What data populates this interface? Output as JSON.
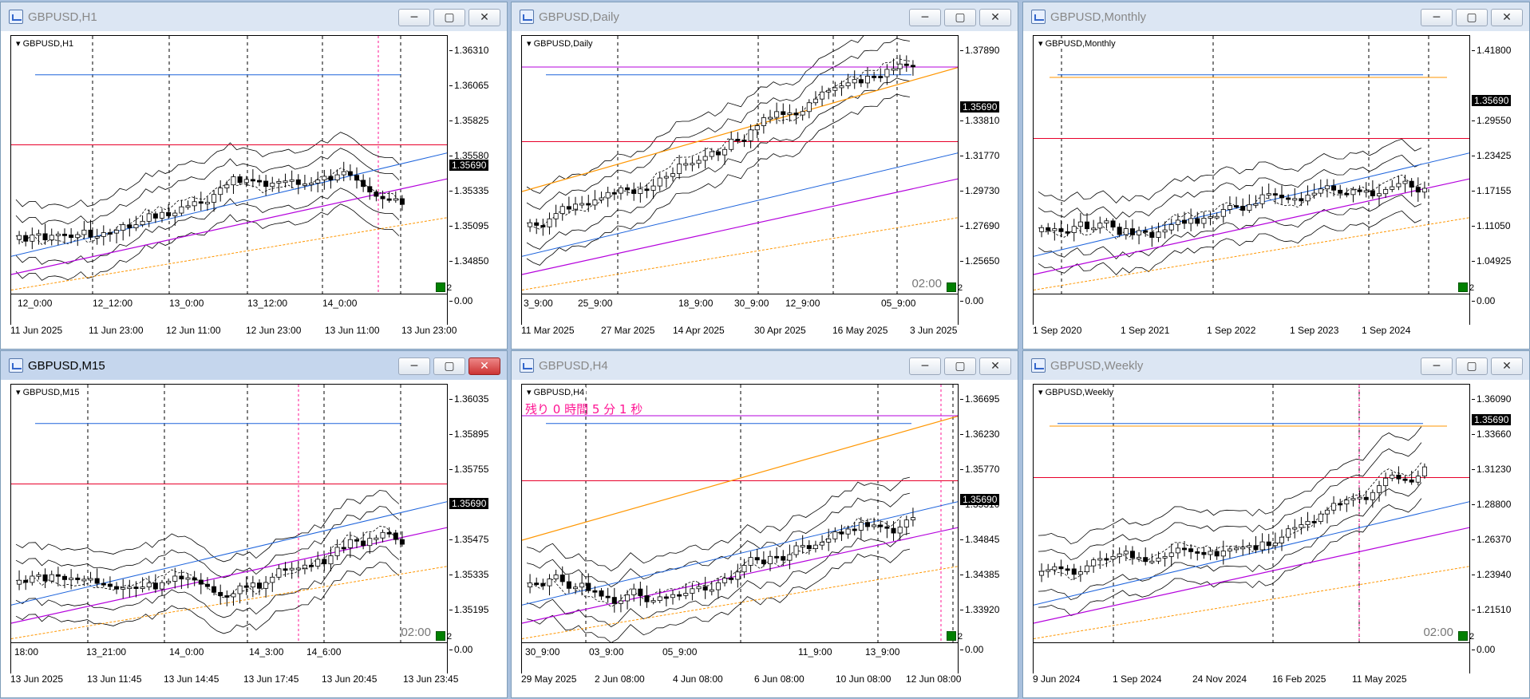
{
  "windows": [
    {
      "title": "GBPUSD,H1",
      "symbol": "GBPUSD,H1",
      "active": false,
      "close_red": false,
      "prices": [
        "1.36310",
        "1.36065",
        "1.35825",
        "1.35580",
        "1.35335",
        "1.35095",
        "1.34850",
        "0.00"
      ],
      "current_price": "1.35690",
      "time_labels": [
        "12_0:00",
        "12_12:00",
        "13_0:00",
        "13_12:00",
        "14_0:00"
      ],
      "date_labels": [
        "11 Jun 2025",
        "11 Jun 23:00",
        "12 Jun 11:00",
        "12 Jun 23:00",
        "13 Jun 11:00",
        "13 Jun 23:00"
      ],
      "axis_zero": "2",
      "countdown": "",
      "timer": ""
    },
    {
      "title": "GBPUSD,Daily",
      "symbol": "GBPUSD,Daily",
      "active": false,
      "close_red": false,
      "prices": [
        "1.37890",
        "1.35690",
        "1.33810",
        "1.31770",
        "1.29730",
        "1.27690",
        "1.25650",
        "0.00"
      ],
      "current_price": "1.35690",
      "time_labels": [
        "3_9:00",
        "25_9:00",
        "18_9:00",
        "30_9:00",
        "12_9:00",
        "05_9:00"
      ],
      "date_labels": [
        "11 Mar 2025",
        "27 Mar 2025",
        "14 Apr 2025",
        "30 Apr 2025",
        "16 May 2025",
        "3 Jun 2025"
      ],
      "axis_zero": "2",
      "countdown": "",
      "timer": "02:00"
    },
    {
      "title": "GBPUSD,Monthly",
      "symbol": "GBPUSD,Monthly",
      "active": false,
      "close_red": false,
      "prices": [
        "1.41800",
        "1.35690",
        "1.29550",
        "1.23425",
        "1.17155",
        "1.11050",
        "1.04925",
        "0.00"
      ],
      "current_price": "1.35690",
      "time_labels": [],
      "date_labels": [
        "1 Sep 2020",
        "1 Sep 2021",
        "1 Sep 2022",
        "1 Sep 2023",
        "1 Sep 2024"
      ],
      "axis_zero": "2",
      "countdown": "",
      "timer": ""
    },
    {
      "title": "GBPUSD,M15",
      "symbol": "GBPUSD,M15",
      "active": true,
      "close_red": true,
      "prices": [
        "1.36035",
        "1.35895",
        "1.35755",
        "1.35615",
        "1.35475",
        "1.35335",
        "1.35195",
        "0.00"
      ],
      "current_price": "1.35690",
      "time_labels": [
        "18:00",
        "13_21:00",
        "14_0:00",
        "14_3:00",
        "14_6:00"
      ],
      "date_labels": [
        "13 Jun 2025",
        "13 Jun 11:45",
        "13 Jun 14:45",
        "13 Jun 17:45",
        "13 Jun 20:45",
        "13 Jun 23:45"
      ],
      "axis_zero": "2",
      "countdown": "",
      "timer": "02:00"
    },
    {
      "title": "GBPUSD,H4",
      "symbol": "GBPUSD,H4",
      "active": false,
      "close_red": false,
      "prices": [
        "1.36695",
        "1.36230",
        "1.35770",
        "1.35310",
        "1.34845",
        "1.34385",
        "1.33920",
        "0.00"
      ],
      "current_price": "1.35690",
      "time_labels": [
        "30_9:00",
        "03_9:00",
        "05_9:00",
        "11_9:00",
        "13_9:00"
      ],
      "date_labels": [
        "29 May 2025",
        "2 Jun 08:00",
        "4 Jun 08:00",
        "6 Jun 08:00",
        "10 Jun 08:00",
        "12 Jun 08:00"
      ],
      "axis_zero": "2",
      "countdown": "残り 0 時間 5 分 1 秒",
      "timer": ""
    },
    {
      "title": "GBPUSD,Weekly",
      "symbol": "GBPUSD,Weekly",
      "active": false,
      "close_red": false,
      "prices": [
        "1.36090",
        "1.33660",
        "1.31230",
        "1.28800",
        "1.26370",
        "1.23940",
        "1.21510",
        "0.00"
      ],
      "current_price": "1.35690",
      "time_labels": [],
      "date_labels": [
        "9 Jun 2024",
        "1 Sep 2024",
        "24 Nov 2024",
        "16 Feb 2025",
        "11 May 2025"
      ],
      "axis_zero": "2",
      "countdown": "",
      "timer": "02:00"
    }
  ],
  "buttons": {
    "minimize": "─",
    "maximize": "▢",
    "close": "✕"
  },
  "colors": {
    "bg": "#a9c0dd",
    "bull": "#ffffff",
    "bear": "#000000",
    "bands": "#000000",
    "red_line": "#e8002a",
    "blue_line": "#1e64dc",
    "purple_line": "#b400dc",
    "orange_line": "#ff9600",
    "vline": "#000000",
    "pink_vline": "#ff1493",
    "countdown": "#ff1493"
  }
}
